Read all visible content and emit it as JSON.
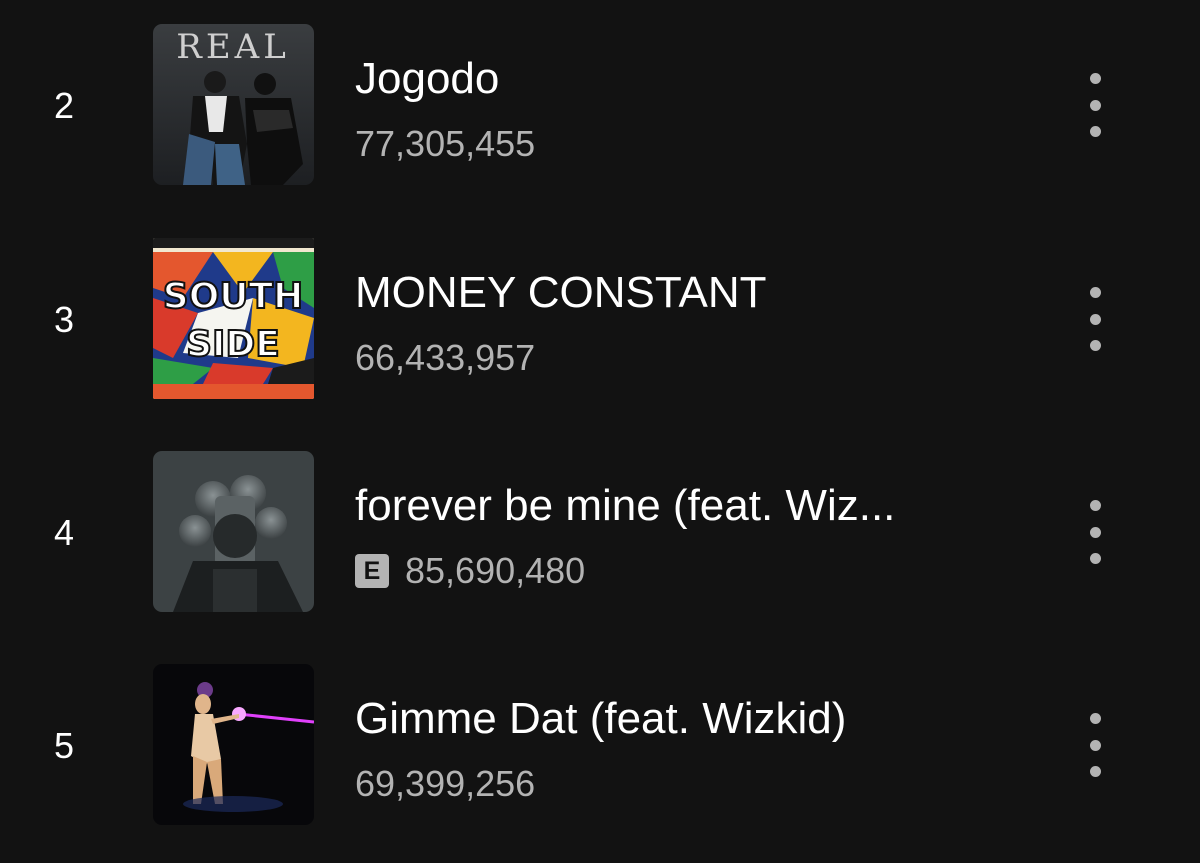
{
  "tracks": [
    {
      "rank": "2",
      "title": "Jogodo",
      "plays": "77,305,455",
      "explicit": false,
      "art_text": "REAL",
      "art_icon": "album-art-jogodo"
    },
    {
      "rank": "3",
      "title": "MONEY CONSTANT",
      "plays": "66,433,957",
      "explicit": false,
      "art_icon": "album-art-money-constant"
    },
    {
      "rank": "4",
      "title": "forever be mine (feat. Wiz...",
      "plays": "85,690,480",
      "explicit": true,
      "explicit_label": "E",
      "art_icon": "album-art-forever-be-mine"
    },
    {
      "rank": "5",
      "title": "Gimme Dat (feat. Wizkid)",
      "plays": "69,399,256",
      "explicit": false,
      "art_icon": "album-art-gimme-dat"
    }
  ],
  "icons": {
    "more": "more-vertical-icon"
  },
  "colors": {
    "background": "#121212",
    "primary_text": "#ffffff",
    "secondary_text": "#b3b3b3"
  }
}
